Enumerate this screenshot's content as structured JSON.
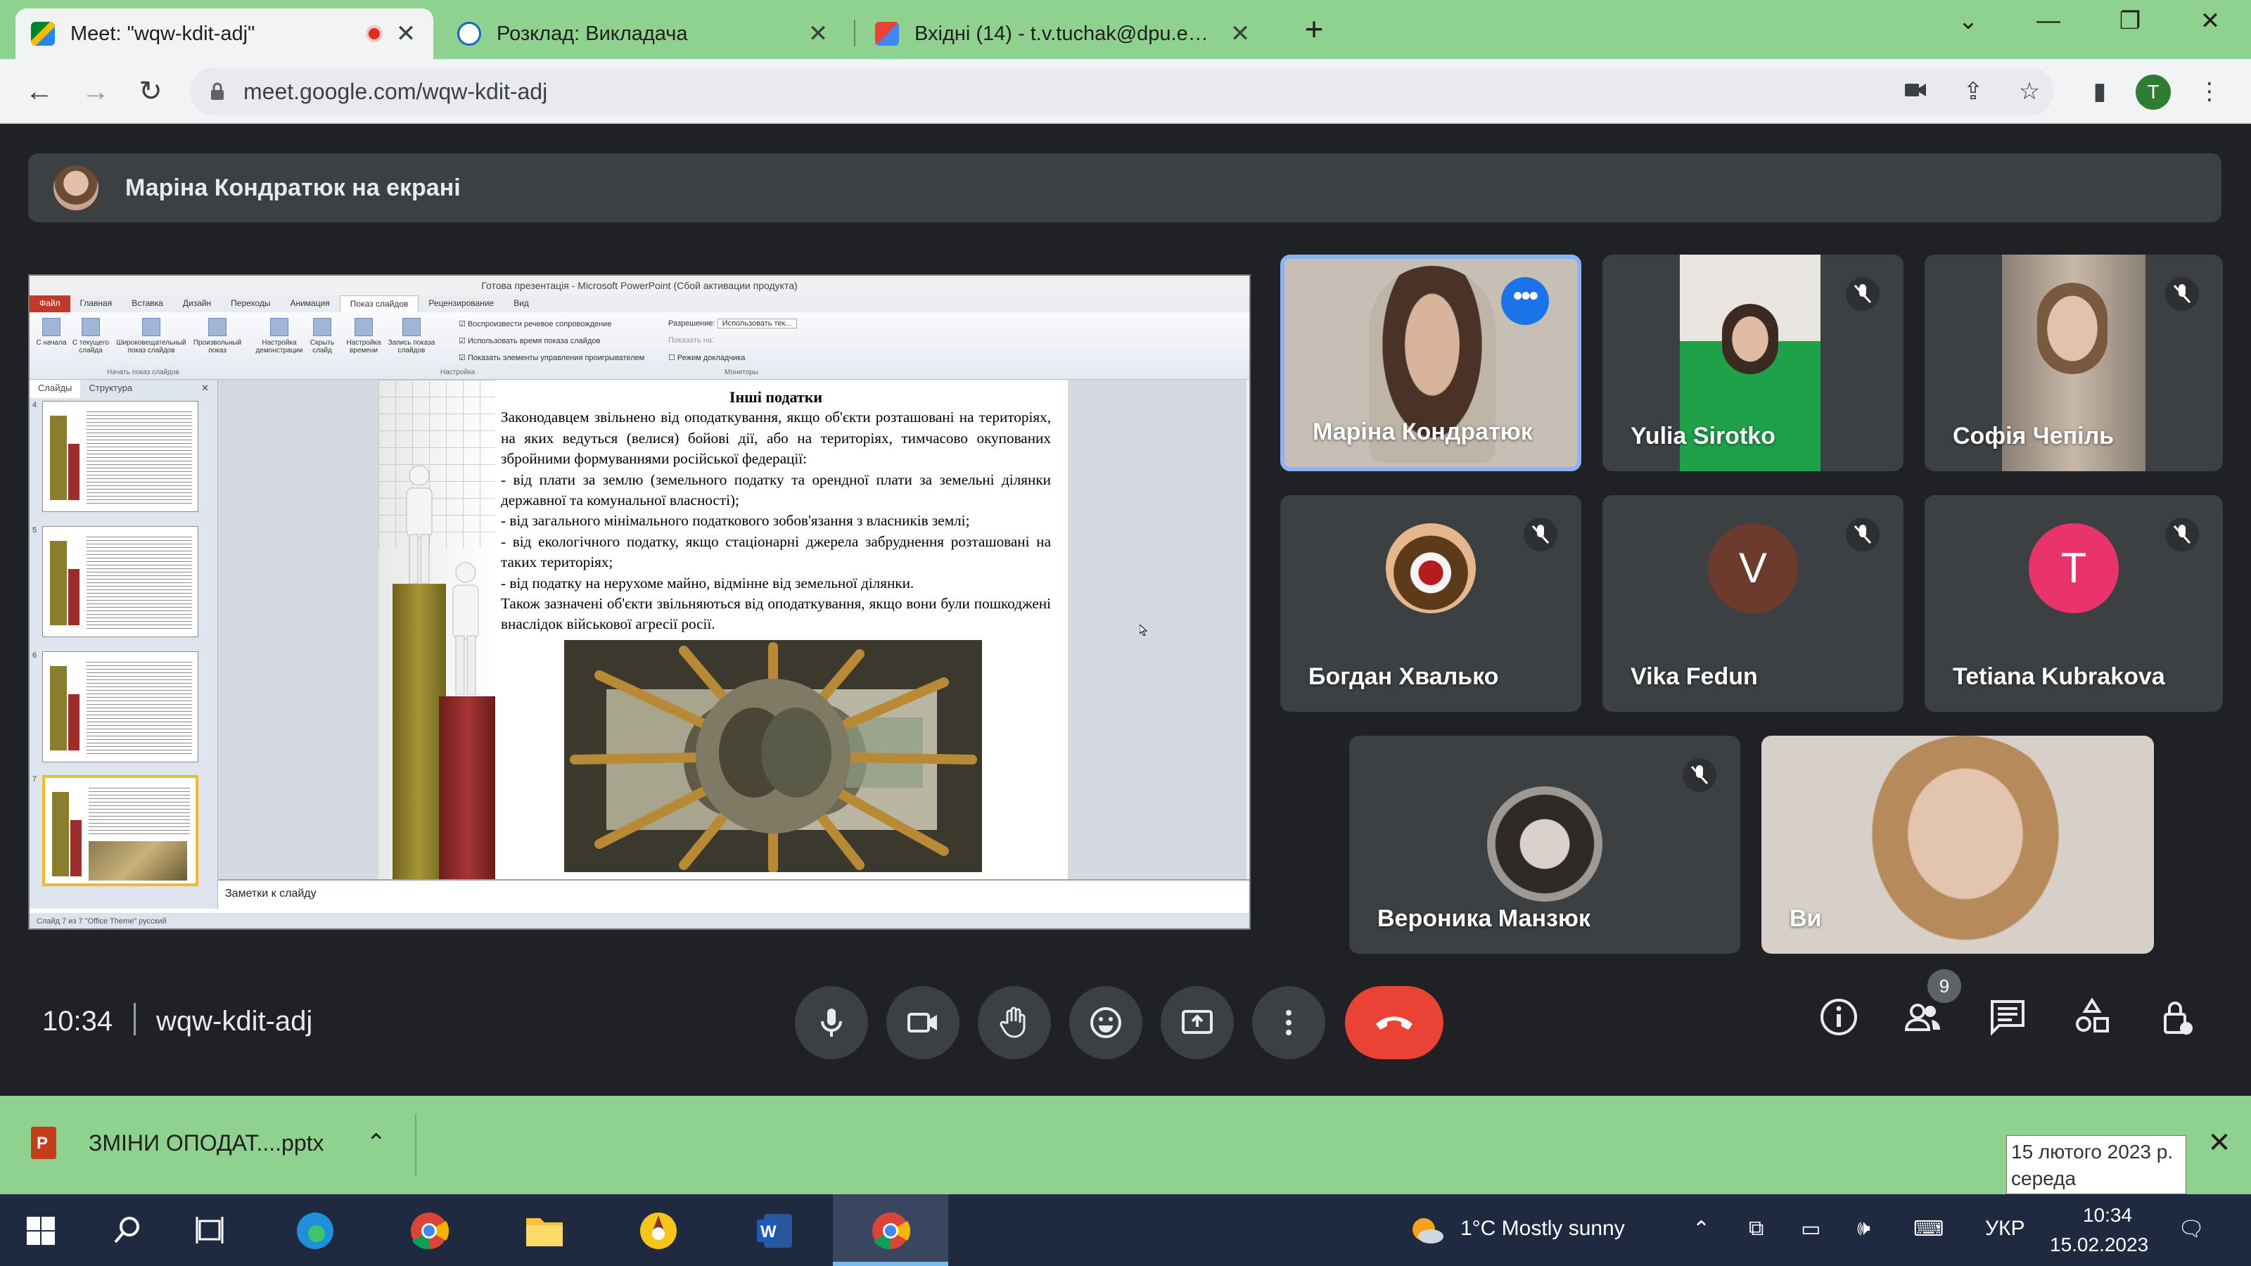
{
  "browser": {
    "tabs": [
      {
        "title": "Meet: \"wqw-kdit-adj\"",
        "active": true
      },
      {
        "title": "Розклад: Викладача",
        "active": false
      },
      {
        "title": "Вхідні (14) - t.v.tuchak@dpu.edu.ua",
        "active": false
      }
    ],
    "url": "meet.google.com/wqw-kdit-adj",
    "profile_initial": "T"
  },
  "meet": {
    "presenter_label": "Маріна Кондратюк на екрані",
    "clock": "10:34",
    "meeting_code": "wqw-kdit-adj",
    "participant_count": "9",
    "participants": [
      {
        "name": "Маріна Кондратюк",
        "muted": false,
        "speaking": true
      },
      {
        "name": "Yulia Sirotko",
        "muted": true
      },
      {
        "name": "Софія Чепіль",
        "muted": true
      },
      {
        "name": "Богдан Хвалько",
        "muted": true
      },
      {
        "name": "Vika Fedun",
        "muted": true,
        "initial": "V",
        "color": "#6d3b2e"
      },
      {
        "name": "Tetiana Kubrakova",
        "muted": true,
        "initial": "T",
        "color": "#e8336d"
      },
      {
        "name": "Вероника Манзюк",
        "muted": true
      },
      {
        "name": "Ви",
        "muted": false
      }
    ]
  },
  "presentation": {
    "window_title": "Готова презентація - Microsoft PowerPoint (Сбой активации продукта)",
    "ribbon_tabs": [
      "Файл",
      "Главная",
      "Вставка",
      "Дизайн",
      "Переходы",
      "Анимация",
      "Показ слайдов",
      "Рецензирование",
      "Вид"
    ],
    "ribbon_buttons": [
      "С начала",
      "С текущего слайда",
      "Широковещательный показ слайдов",
      "Произвольный показ",
      "Настройка демонстрации",
      "Скрыть слайд",
      "Настройка времени",
      "Запись показа слайдов"
    ],
    "ribbon_checks": [
      "Воспроизвести речевое сопровождение",
      "Использовать время показа слайдов",
      "Показать элементы управления проигрывателем"
    ],
    "ribbon_right": [
      "Разрешение:",
      "Использовать тек...",
      "Показать на:",
      "Режим докладчика"
    ],
    "ribbon_groups": [
      "Начать показ слайдов",
      "Настройка",
      "Мониторы"
    ],
    "left_tabs": [
      "Слайды",
      "Структура"
    ],
    "thumb_numbers": [
      "4",
      "5",
      "6",
      "7"
    ],
    "slide": {
      "heading": "Інші податки",
      "body": [
        "Законодавцем звільнено від оподаткування, якщо об'єкти розташовані на територіях, на яких ведуться (велися) бойові дії, або на територіях, тимчасово окупованих збройними формуваннями російської федерації:",
        "- від плати за землю (земельного податку та орендної плати за земельні ділянки державної та комунальної власності);",
        "- від загального мінімального податкового зобов'язання з власників землі;",
        "- від екологічного податку, якщо стаціонарні джерела забруднення розташовані на таких територіях;",
        "- від податку на нерухоме майно, відмінне від земельної ділянки.",
        "Також зазначені об'єкти звільняються від оподаткування, якщо вони були пошкоджені внаслідок військової агресії росії."
      ]
    },
    "notes_placeholder": "Заметки к слайду",
    "status": "Слайд 7 из 7   \"Office Theme\"   русский"
  },
  "downloads": {
    "file": "ЗМІНИ ОПОДАТ....pptx"
  },
  "tooltip": {
    "date": "15 лютого 2023 р.",
    "day": "середа"
  },
  "taskbar": {
    "weather": "1°C  Mostly sunny",
    "lang": "УКР",
    "time": "10:34",
    "date": "15.02.2023"
  },
  "colors": {
    "tab_bar": "#8fd18e",
    "meet_bg": "#202124",
    "tile_bg": "#3c4043",
    "end_call": "#ea4335",
    "speaking_border": "#8ab4f8"
  }
}
